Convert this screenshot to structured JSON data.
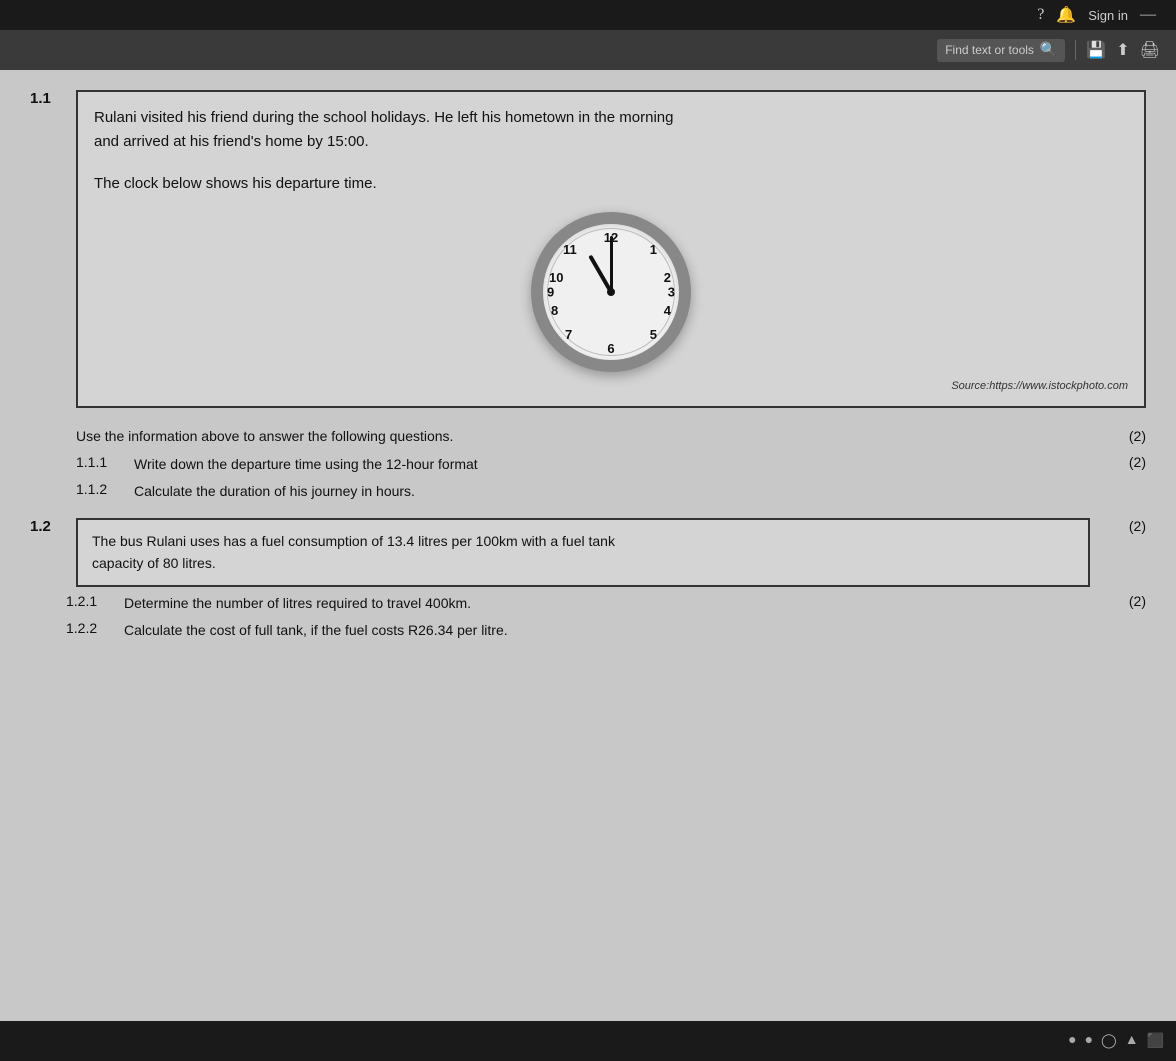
{
  "topbar": {
    "sign_in": "Sign in"
  },
  "toolbar": {
    "find_text_label": "Find text or tools",
    "find_icon": "🔍"
  },
  "content": {
    "question_1_1_number": "1.1",
    "question_1_1_text_line1": "Rulani visited his friend during the school holidays. He left his hometown in the morning",
    "question_1_1_text_line2": "and arrived at his friend's home by 15:00.",
    "question_1_1_clock_label": "The clock below shows his departure time.",
    "clock_source": "Source:https://www.istockphoto.com",
    "use_info": "Use the information above to answer the following questions.",
    "marks_use_info": "(2)",
    "sub_1_1_1_number": "1.1.1",
    "sub_1_1_1_text": "Write down the departure time using the 12-hour format",
    "sub_1_1_1_marks": "(2)",
    "sub_1_1_2_number": "1.1.2",
    "sub_1_1_2_text": "Calculate the duration of his journey in hours.",
    "sub_1_1_2_marks": "",
    "question_1_2_number": "1.2",
    "question_1_2_text": "The bus Rulani uses has a fuel consumption of 13.4 litres per 100km with a fuel tank\ncapacity of 80 litres.",
    "question_1_2_marks": "(2)",
    "sub_1_2_1_number": "1.2.1",
    "sub_1_2_1_text": "Determine the number of litres required to travel 400km.",
    "sub_1_2_1_marks": "(2)",
    "sub_1_2_2_number": "1.2.2",
    "sub_1_2_2_text": "Calculate the cost of full tank, if the fuel costs R26.34 per litre.",
    "sub_1_2_2_marks": ""
  },
  "clock": {
    "numbers": [
      "12",
      "1",
      "2",
      "3",
      "4",
      "5",
      "6",
      "7",
      "8",
      "9",
      "10",
      "11"
    ],
    "hour_rotation": -30,
    "minute_rotation": 0
  }
}
